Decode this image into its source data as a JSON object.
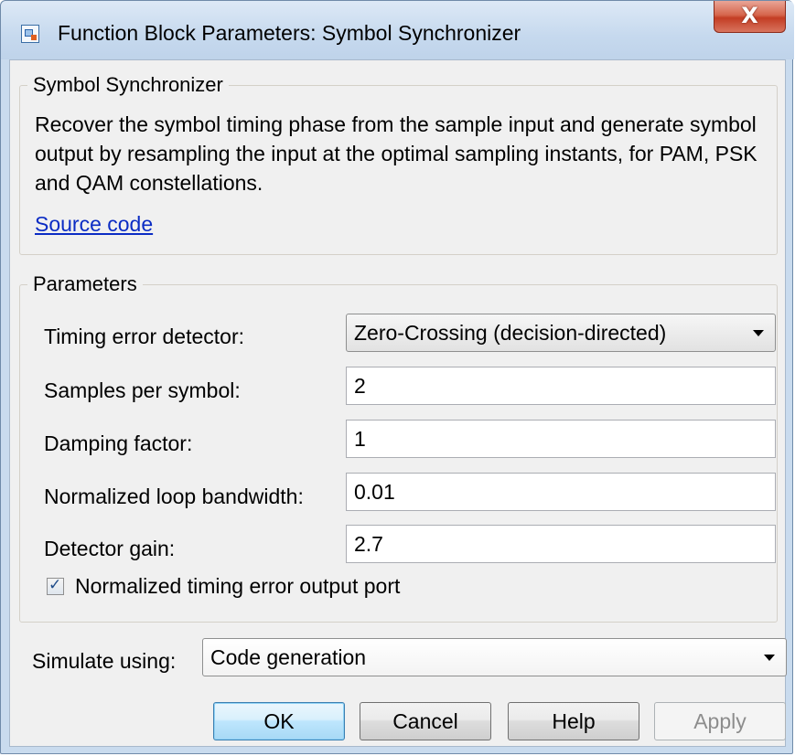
{
  "window": {
    "title": "Function Block Parameters: Symbol Synchronizer",
    "close_symbol": "X"
  },
  "block": {
    "group_title": "Symbol Synchronizer",
    "description": "Recover the symbol timing phase from the sample input and generate symbol output by resampling the input at the optimal sampling instants, for PAM, PSK and QAM constellations.",
    "link": "Source code"
  },
  "parameters": {
    "group_title": "Parameters",
    "timing_error_detector": {
      "label": "Timing error detector:",
      "value": "Zero-Crossing (decision-directed)"
    },
    "samples_per_symbol": {
      "label": "Samples per symbol:",
      "value": "2"
    },
    "damping_factor": {
      "label": "Damping factor:",
      "value": "1"
    },
    "normalized_loop_bandwidth": {
      "label": "Normalized loop bandwidth:",
      "value": "0.01"
    },
    "detector_gain": {
      "label": "Detector gain:",
      "value": "2.7"
    },
    "normalized_timing_error_port": {
      "label": "Normalized timing error output port",
      "checked": true
    }
  },
  "simulate": {
    "label": "Simulate using:",
    "value": "Code generation"
  },
  "buttons": {
    "ok": "OK",
    "cancel": "Cancel",
    "help": "Help",
    "apply": "Apply"
  },
  "icons": {
    "app": "simulink-block-icon",
    "close": "close-icon",
    "dropdown": "chevron-down-icon",
    "check": "checkmark-icon"
  }
}
